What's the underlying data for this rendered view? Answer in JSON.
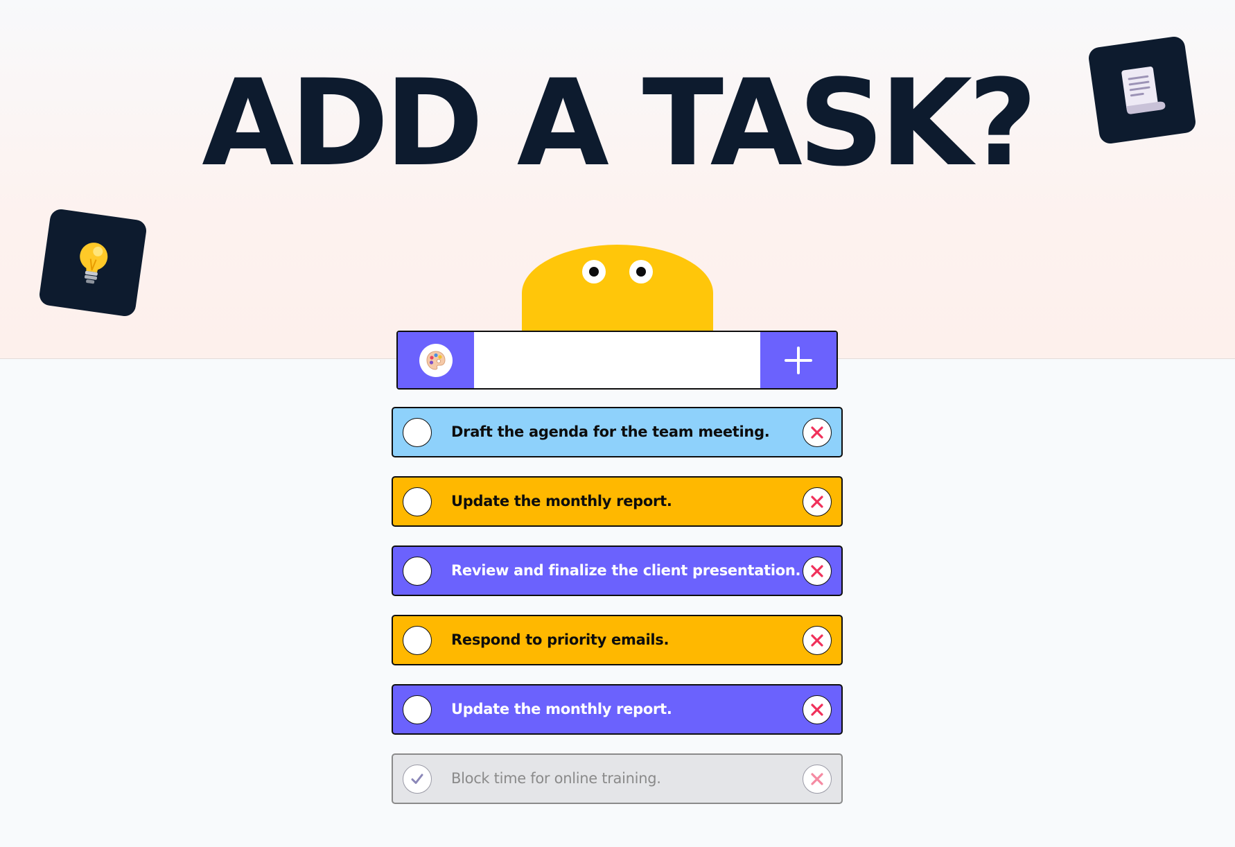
{
  "header": {
    "title": "ADD A TASK?"
  },
  "decorations": {
    "left_tile_icon": "light-bulb-icon",
    "right_tile_icon": "scroll-note-icon",
    "mascot": "yellow-peeking-mascot"
  },
  "input_bar": {
    "palette_icon": "palette-icon",
    "value": "",
    "placeholder": "",
    "add_icon": "plus-icon",
    "accent_color": "#6b62fd"
  },
  "tasks": [
    {
      "text": "Draft the agenda for the team meeting.",
      "color": "#8ed1fb",
      "text_color": "#0d0d0d",
      "completed": false
    },
    {
      "text": "Update the monthly report.",
      "color": "#ffb800",
      "text_color": "#0d0d0d",
      "completed": false
    },
    {
      "text": "Review and finalize the client presentation.",
      "color": "#6b62fd",
      "text_color": "#ffffff",
      "completed": false
    },
    {
      "text": "Respond to priority emails.",
      "color": "#ffb800",
      "text_color": "#0d0d0d",
      "completed": false
    },
    {
      "text": "Update the monthly report.",
      "color": "#6b62fd",
      "text_color": "#ffffff",
      "completed": false
    },
    {
      "text": "Block time for online training.",
      "color": "#e4e5e8",
      "text_color": "#8a8a8a",
      "completed": true
    }
  ],
  "colors": {
    "title": "#0d1b2e",
    "tile": "#0d1b2e",
    "mascot": "#ffc60a",
    "delete_x": "#f0305a"
  }
}
